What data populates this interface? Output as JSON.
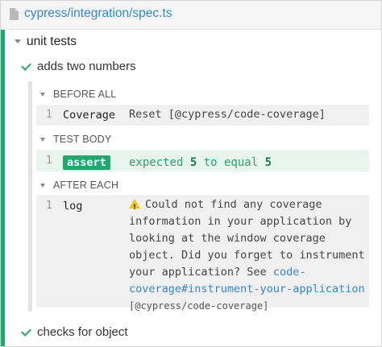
{
  "file": {
    "path": "cypress/integration/spec.ts",
    "icon": "file-icon"
  },
  "suite": {
    "title": "unit tests"
  },
  "tests": [
    {
      "title": "adds two numbers",
      "state": "passed",
      "hooks": [
        {
          "title": "BEFORE ALL",
          "commands": [
            {
              "num": "1",
              "name": "Coverage",
              "message": "Reset [@cypress/code-coverage]"
            }
          ]
        },
        {
          "title": "TEST BODY",
          "commands": [
            {
              "num": "1",
              "name": "assert",
              "message_parts": [
                "expected ",
                "5",
                " to equal ",
                "5"
              ]
            }
          ]
        },
        {
          "title": "AFTER EACH",
          "commands": [
            {
              "num": "1",
              "name": "log",
              "message_line1": "Could not find any coverage",
              "message_line2": "information in your application by",
              "message_line3": "looking at the window coverage",
              "message_line4": "object. Did you forget to instrument",
              "message_line5_prefix": "your application? See ",
              "message_link_part1": "code-",
              "message_link_part2": "coverage#instrument-your-application",
              "message_suffix": "[@cypress/code-coverage]"
            }
          ]
        }
      ]
    },
    {
      "title": "checks for object",
      "state": "passed"
    }
  ],
  "colors": {
    "pass": "#1fa971",
    "link": "#3386d4",
    "warning": "#f0c419"
  }
}
